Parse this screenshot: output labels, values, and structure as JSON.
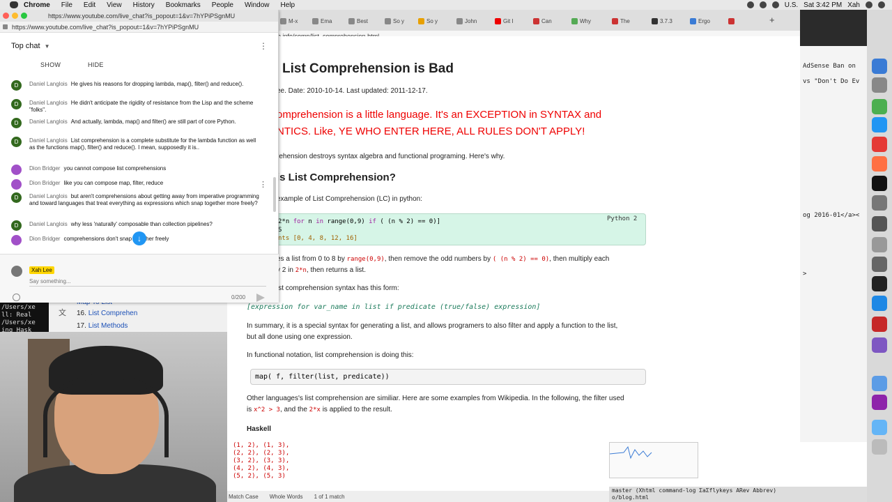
{
  "menubar": {
    "items": [
      "Chrome",
      "File",
      "Edit",
      "View",
      "History",
      "Bookmarks",
      "People",
      "Window",
      "Help"
    ],
    "clock": "Sat 3:42 PM",
    "user": "Xah",
    "locale": "U.S."
  },
  "chat_window": {
    "title_url": "https://www.youtube.com/live_chat?is_popout=1&v=7hYPiPSgnMU",
    "address": "https://www.youtube.com/live_chat?is_popout=1&v=7hYPiPSgnMU",
    "header": "Top chat",
    "show_label": "SHOW",
    "hide_label": "HIDE",
    "messages": [
      {
        "initial": "D",
        "author": "Daniel Langlois",
        "text": "He gives his reasons for dropping lambda, map(), filter() and reduce()."
      },
      {
        "initial": "D",
        "author": "Daniel Langlois",
        "text": "He didn't anticipate the rigidity of resistance from the Lisp and the scheme \"folks\"."
      },
      {
        "initial": "D",
        "author": "Daniel Langlois",
        "text": "And actually, lambda, map() and filter() are still part of core Python."
      },
      {
        "initial": "D",
        "author": "Daniel Langlois",
        "text": "List comprehension is a complete substitute for the lambda function as well as the functions map(), filter() and reduce(). I mean, supposedly it is.."
      },
      {
        "initial": "",
        "author": "Dion Bridger",
        "text": "you cannot compose list comprehensions"
      },
      {
        "initial": "",
        "author": "Dion Bridger",
        "text": "like you can compose map, filter, reduce"
      },
      {
        "initial": "D",
        "author": "Daniel Langlois",
        "text": "but aren't comprehensions about getting away from imperative programming and toward languages that treat everything as expressions which snap together more freely?"
      },
      {
        "initial": "D",
        "author": "Daniel Langlois",
        "text": "why less 'naturally' composable than collection pipelines?"
      },
      {
        "initial": "",
        "author": "Dion Bridger",
        "text": "comprehensions don't snap together freely"
      }
    ],
    "self_name": "Xah Lee",
    "input_placeholder": "Say something...",
    "char_count": "0/200"
  },
  "browser": {
    "tabs": [
      "M-x",
      "Ema",
      "Best",
      "So y",
      "So y",
      "John",
      "Git I",
      "Can",
      "Why",
      "The",
      "3.7.3",
      "Ergo"
    ],
    "address": "e.info/comp/list_comprehension.html"
  },
  "page": {
    "title": "List Comprehension is Bad",
    "dates": "ee. Date: 2010-10-14. Last updated: 2011-12-17.",
    "red_line1": "omprehension is a little language. It's an EXCEPTION in SYNTAX and",
    "red_line2": "NTICS. Like, YE WHO ENTER HERE, ALL RULES DON'T APPLY!",
    "intro": "rehension destroys syntax algebra and functional programing. Here's why.",
    "h2": "is List Comprehension?",
    "example_intro": "example of List Comprehension (LC) in python:",
    "code_lang": "Python 2",
    "code_line1_a": "2*n",
    "code_line1_b": "for",
    "code_line1_c": "n",
    "code_line1_d": "in",
    "code_line1_e": "range(0,9)",
    "code_line1_f": "if",
    "code_line1_g": "( (n % 2) == 0)]",
    "code_line2": "S",
    "code_line3": "nts [0, 4, 8, 12, 16]",
    "explain1_a": "es a list from 0 to 8 by",
    "explain1_code1": "range(0,9)",
    "explain1_b": ", then remove the odd numbers by",
    "explain1_code2": "( (n % 2) == 0)",
    "explain1_c": ", then multiply each",
    "explain2_a": "y 2 in",
    "explain2_code": "2*n",
    "explain2_b": ", then returns a list.",
    "syntax_intro": "ist comprehension syntax has this form:",
    "syntax": "[expression for var_name in list if predicate (true/false) expression]",
    "summary1": "In summary, it is a special syntax for generating a list, and allows programers to also filter and apply a function to the list,",
    "summary2": "but all done using one expression.",
    "functional": "In functional notation, list comprehension is doing this:",
    "map_code": "map( f, filter(list, predicate))",
    "other1": "Other languages's list comprehension are similiar. Here are some examples from Wikipedia. In the following, the filter used",
    "other2_a": "is",
    "other2_code1": "x^2 > 3",
    "other2_b": ", and the",
    "other2_code2": "2*x",
    "other2_c": "is applied to the result.",
    "haskell": "Haskell"
  },
  "lower": {
    "tuples": [
      "(1, 2), (1, 3),",
      "(2, 2), (2, 3),",
      "(3, 2), (3, 3),",
      "(4, 2), (4, 3),",
      "(5, 2), (5, 3)"
    ],
    "find_options": [
      "Match Case",
      "Whole Words",
      "1 of 1 match"
    ],
    "modeline1": "master  (Xhtml command-log ΣaΣflykeys ARev Abbrev)",
    "modeline2": "o/blog.html"
  },
  "terminal": {
    "line1": "AdSense Ban on",
    "line2": "vs \"Don't Do Ev",
    "line3": "og 2016-01</a><",
    "line4": ">"
  },
  "bg_left": {
    "term_lines": [
      "/Users/xe",
      "ll: Real",
      "/Users/xe",
      "ing Hask"
    ],
    "items": [
      {
        "num": "16.",
        "label": "List Comprehen"
      },
      {
        "num": "17.",
        "label": "List Methods"
      }
    ],
    "partial": "Map To List"
  },
  "colors": {
    "red_text": "#e00000",
    "code_bg": "#d6f5e7",
    "link": "#1a4fb6",
    "avatar_green": "#33691e",
    "avatar_purple": "#a150c8",
    "self_badge": "#ffd600"
  }
}
